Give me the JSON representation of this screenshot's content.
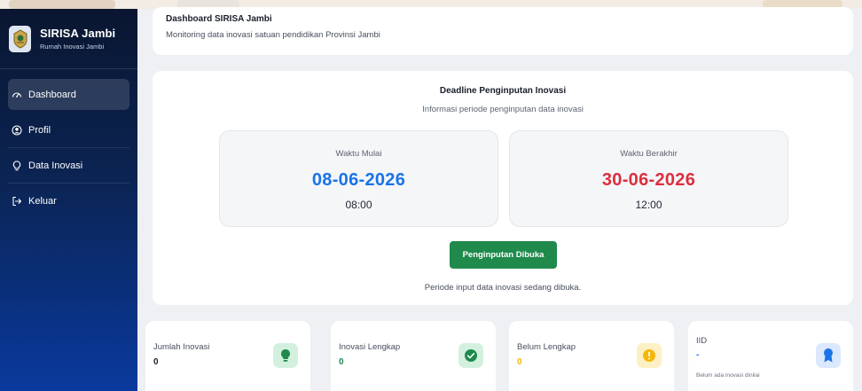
{
  "brand": {
    "title": "SIRISA Jambi",
    "subtitle": "Rumah Inovasi Jambi"
  },
  "sidebar": {
    "items": [
      {
        "label": "Dashboard",
        "icon": "gauge-icon",
        "active": true
      },
      {
        "label": "Profil",
        "icon": "user-circle-icon",
        "active": false
      },
      {
        "label": "Data Inovasi",
        "icon": "lightbulb-icon",
        "active": false
      },
      {
        "label": "Keluar",
        "icon": "logout-icon",
        "active": false
      }
    ]
  },
  "header": {
    "title": "Dashboard SIRISA Jambi",
    "subtitle": "Monitoring data inovasi satuan pendidikan Provinsi Jambi"
  },
  "deadline": {
    "title": "Deadline Penginputan Inovasi",
    "subtitle": "Informasi periode penginputan data inovasi",
    "start": {
      "label": "Waktu Mulai",
      "date": "08-06-2026",
      "time": "08:00",
      "color": "#1a73e8"
    },
    "end": {
      "label": "Waktu Berakhir",
      "date": "30-06-2026",
      "time": "12:00",
      "color": "#dc2f3f"
    },
    "status_button": "Penginputan Dibuka",
    "note": "Periode input data inovasi sedang dibuka."
  },
  "stats": [
    {
      "label": "Jumlah Inovasi",
      "value": "0",
      "icon": "lightbulb-icon",
      "icon_bg": "#d3f0df",
      "icon_color": "#1f8a4c"
    },
    {
      "label": "Inovasi Lengkap",
      "value": "0",
      "icon": "check-circle-icon",
      "icon_bg": "#d3f0df",
      "icon_color": "#1f8a4c"
    },
    {
      "label": "Belum Lengkap",
      "value": "0",
      "icon": "alert-circle-icon",
      "icon_bg": "#fdf0c4",
      "icon_color": "#f5b70a"
    },
    {
      "label": "IID",
      "value": "-",
      "note": "Belum ada inovasi dinilai",
      "icon": "award-icon",
      "icon_bg": "#dbe8fd",
      "icon_color": "#1a73e8"
    }
  ],
  "colors": {
    "sidebar_top": "#0a1630",
    "sidebar_bottom": "#0a3a9e",
    "open_button": "#1f8a4c"
  }
}
